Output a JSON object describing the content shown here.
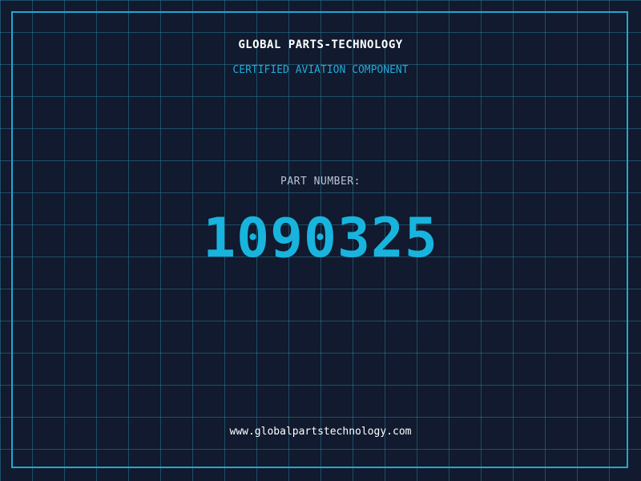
{
  "header": {
    "company": "GLOBAL PARTS-TECHNOLOGY",
    "tagline": "CERTIFIED AVIATION COMPONENT"
  },
  "part": {
    "label": "PART NUMBER:",
    "number": "1090325"
  },
  "footer": {
    "url": "www.globalpartstechnology.com"
  },
  "colors": {
    "background": "#111a2e",
    "grid": "#287896",
    "accent": "#20a9d0",
    "number": "#18b4de"
  }
}
